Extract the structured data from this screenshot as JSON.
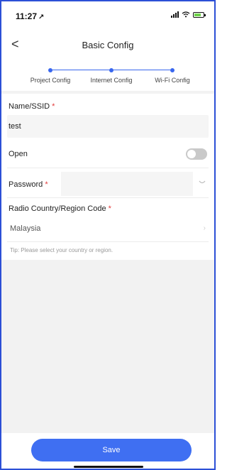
{
  "status_bar": {
    "time": "11:27",
    "location_glyph": "↗",
    "icons": [
      "signal-icon",
      "wifi-icon",
      "battery-icon"
    ]
  },
  "nav": {
    "back_glyph": "<",
    "title": "Basic Config"
  },
  "stepper": {
    "steps": [
      {
        "label": "Project Config"
      },
      {
        "label": "Internet Config"
      },
      {
        "label": "Wi-Fi Config"
      }
    ],
    "accent_color": "#3866ee"
  },
  "form": {
    "ssid": {
      "label": "Name/SSID",
      "required": "*",
      "value": "test"
    },
    "open": {
      "label": "Open",
      "on": false
    },
    "password": {
      "label": "Password",
      "required": "*",
      "value": ""
    },
    "region": {
      "label": "Radio Country/Region Code",
      "required": "*",
      "value": "Malaysia"
    },
    "tip": "Tip: Please select your country or region."
  },
  "footer": {
    "save_label": "Save",
    "button_color": "#3f6ff2"
  }
}
